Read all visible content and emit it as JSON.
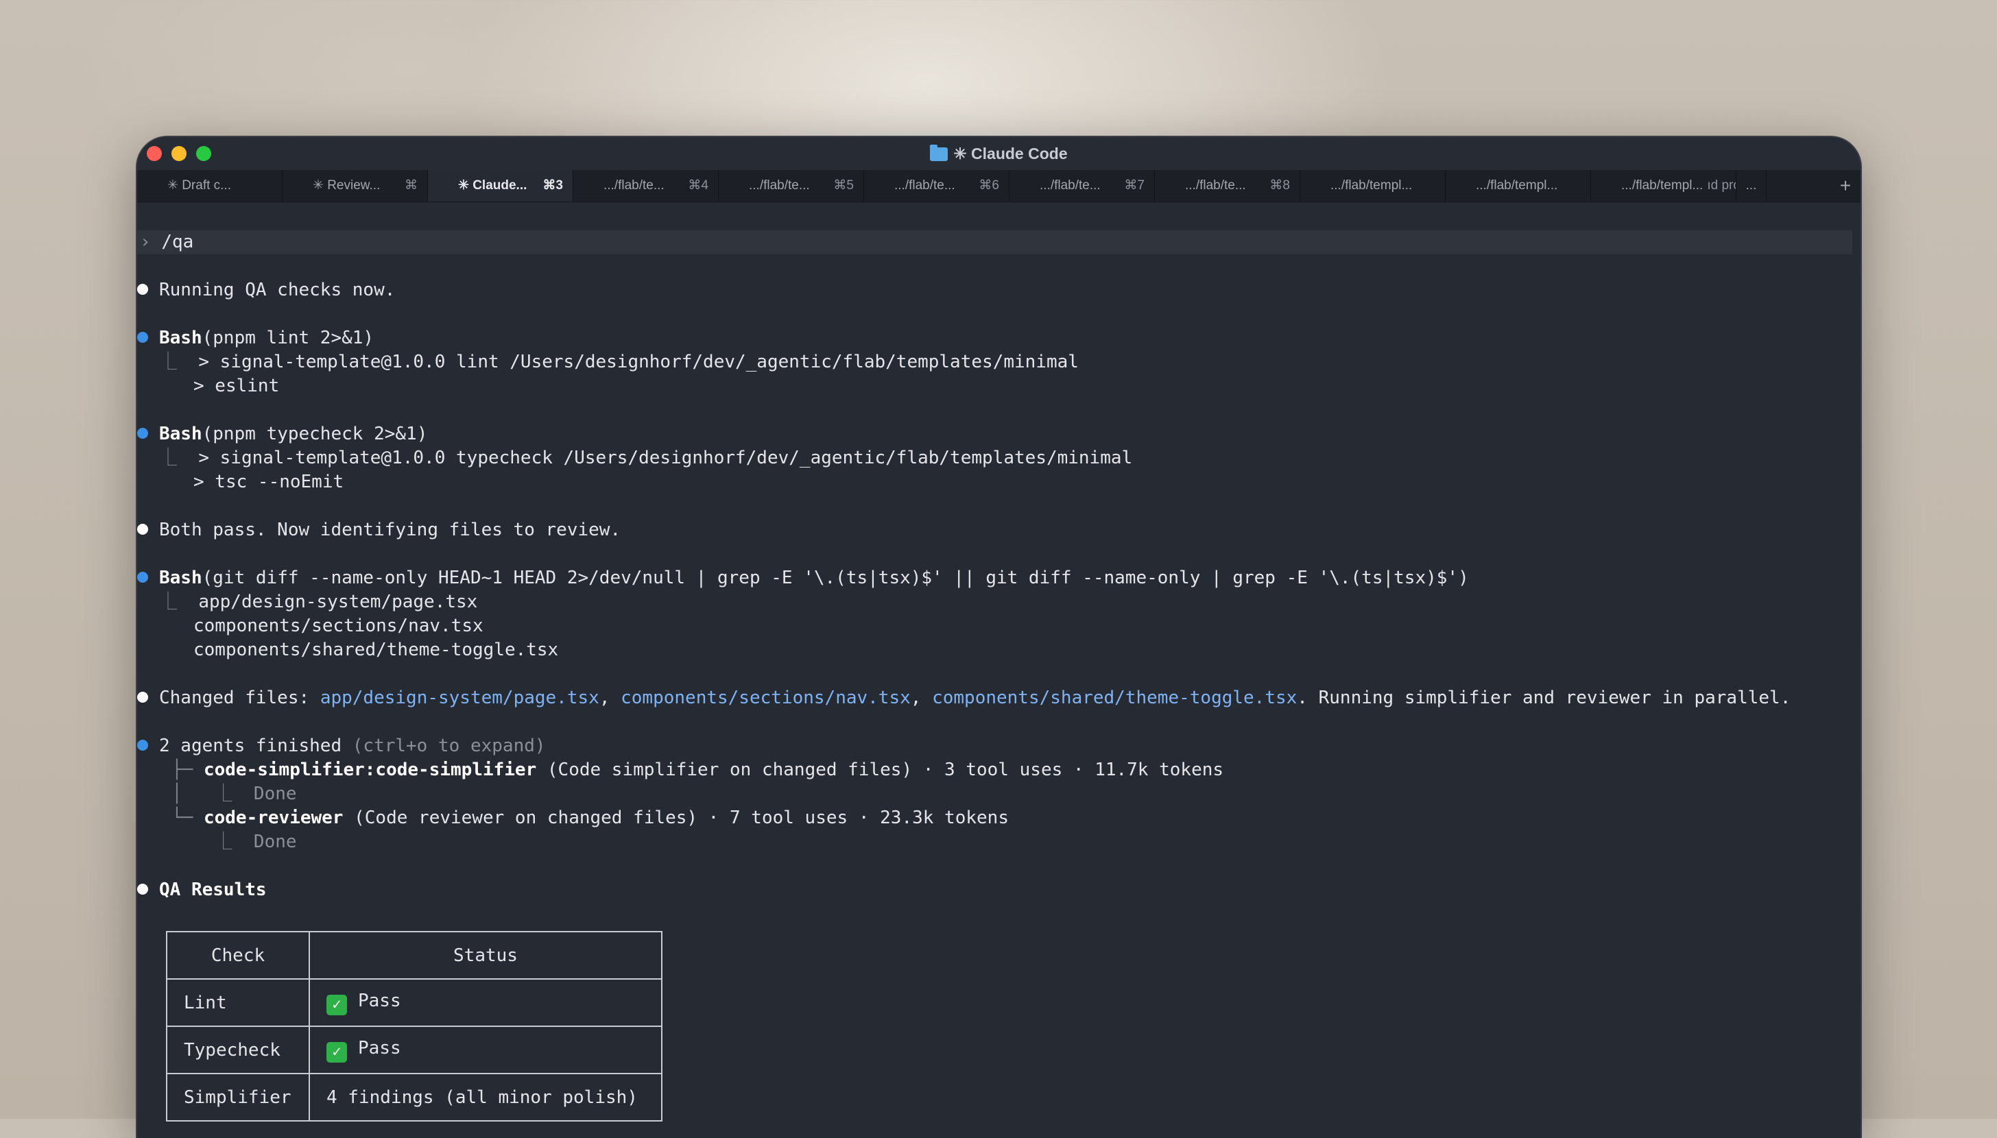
{
  "window": {
    "title": "✳ Claude Code"
  },
  "tabs": [
    {
      "label": "✳ Draft c...",
      "shortcut": ""
    },
    {
      "label": "✳ Review...",
      "shortcut": "⌘"
    },
    {
      "label": "✳ Claude...",
      "shortcut": "⌘3",
      "active": true
    },
    {
      "label": ".../flab/te...",
      "shortcut": "⌘4"
    },
    {
      "label": ".../flab/te...",
      "shortcut": "⌘5"
    },
    {
      "label": ".../flab/te...",
      "shortcut": "⌘6"
    },
    {
      "label": ".../flab/te...",
      "shortcut": "⌘7"
    },
    {
      "label": ".../flab/te...",
      "shortcut": "⌘8"
    },
    {
      "label": ".../flab/templ...",
      "shortcut": ""
    },
    {
      "label": ".../flab/templ...",
      "shortcut": ""
    },
    {
      "label": ".../flab/templ...",
      "shortcut": "ıd prod..."
    },
    {
      "label": "...",
      "shortcut": ""
    }
  ],
  "new_tab_label": "+",
  "prompt": {
    "symbol": "›",
    "text": "/qa"
  },
  "transcript": {
    "msg1": "Running QA checks now.",
    "bash1": {
      "name": "Bash",
      "args": "(pnpm lint 2>&1)",
      "out1": "> signal-template@1.0.0 lint /Users/designhorf/dev/_agentic/flab/templates/minimal",
      "out2": "> eslint"
    },
    "bash2": {
      "name": "Bash",
      "args": "(pnpm typecheck 2>&1)",
      "out1": "> signal-template@1.0.0 typecheck /Users/designhorf/dev/_agentic/flab/templates/minimal",
      "out2": "> tsc --noEmit"
    },
    "msg2": "Both pass. Now identifying files to review.",
    "bash3": {
      "name": "Bash",
      "args": "(git diff --name-only HEAD~1 HEAD 2>/dev/null | grep -E '\\.(ts|tsx)$' || git diff --name-only | grep -E '\\.(ts|tsx)$')",
      "out1": "app/design-system/page.tsx",
      "out2": "components/sections/nav.tsx",
      "out3": "components/shared/theme-toggle.tsx"
    },
    "changed": {
      "prefix": "Changed files: ",
      "file1": "app/design-system/page.tsx",
      "sep1": ", ",
      "file2": "components/sections/nav.tsx",
      "sep2": ", ",
      "file3": "components/shared/theme-toggle.tsx",
      "suffix": ". Running simplifier and reviewer in parallel."
    },
    "agents": {
      "title": "2 agents finished",
      "hint": " (ctrl+o to expand)",
      "agent1": {
        "name": "code-simplifier:code-simplifier",
        "detail": " (Code simplifier on changed files) · 3 tool uses · 11.7k tokens",
        "status": "Done"
      },
      "agent2": {
        "name": "code-reviewer",
        "detail": " (Code reviewer on changed files) · 7 tool uses · 23.3k tokens",
        "status": "Done"
      }
    },
    "results_title": "QA Results"
  },
  "qa_table": {
    "headers": [
      "Check",
      "Status"
    ],
    "rows": [
      {
        "check": "Lint",
        "status": "Pass",
        "icon": "check-mark-icon"
      },
      {
        "check": "Typecheck",
        "status": "Pass",
        "icon": "check-mark-icon"
      },
      {
        "check": "Simplifier",
        "status": "4 findings (all minor polish)"
      }
    ]
  },
  "colors": {
    "bullet_blue": "#3c91e6",
    "link": "#7fb3f3",
    "terminal_bg": "#262a33"
  }
}
